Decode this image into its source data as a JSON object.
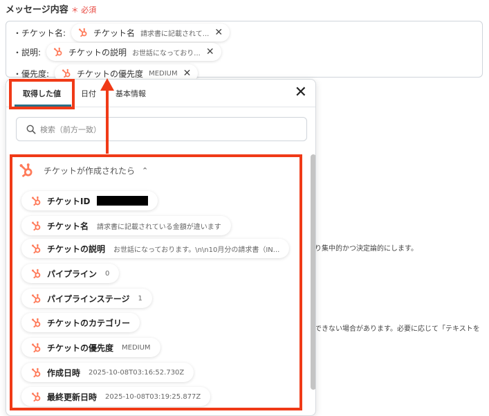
{
  "form": {
    "label": "メッセージ内容",
    "required_mark": "＊",
    "required_text": "必須"
  },
  "message_lines": [
    {
      "prefix": "・チケット名:",
      "chip_label": "チケット名",
      "chip_value": "請求書に記載されて..."
    },
    {
      "prefix": "・説明:",
      "chip_label": "チケットの説明",
      "chip_value": "お世話になっており..."
    },
    {
      "prefix": "・優先度:",
      "chip_label": "チケットの優先度",
      "chip_value": "MEDIUM"
    }
  ],
  "background_text": {
    "line1": "り集中的かつ決定論的にします。",
    "line2": "できない場合があります。必要に応じて「テキストを"
  },
  "popup": {
    "tabs": [
      {
        "label": "取得した値"
      },
      {
        "label": "日付"
      },
      {
        "label": "基本情報"
      }
    ],
    "close_glyph": "✕",
    "search_placeholder": "検索（前方一致）",
    "group_title": "チケットが作成されたら",
    "group_caret": "⌃",
    "items": [
      {
        "label": "チケットID",
        "value": ""
      },
      {
        "label": "チケット名",
        "value": "請求書に記載されている金額が違います"
      },
      {
        "label": "チケットの説明",
        "value": "お世話になっております。\\n\\n10月分の請求書（IN..."
      },
      {
        "label": "パイプライン",
        "value": "0"
      },
      {
        "label": "パイプラインステージ",
        "value": "1"
      },
      {
        "label": "チケットのカテゴリー",
        "value": ""
      },
      {
        "label": "チケットの優先度",
        "value": "MEDIUM"
      },
      {
        "label": "作成日時",
        "value": "2025-10-08T03:16:52.730Z"
      },
      {
        "label": "最終更新日時",
        "value": "2025-10-08T03:19:25.877Z"
      }
    ]
  },
  "colors": {
    "hubspot_orange": "#ff7a59",
    "annotation_red": "#f03a17",
    "tab_accent": "#2a6f87"
  }
}
